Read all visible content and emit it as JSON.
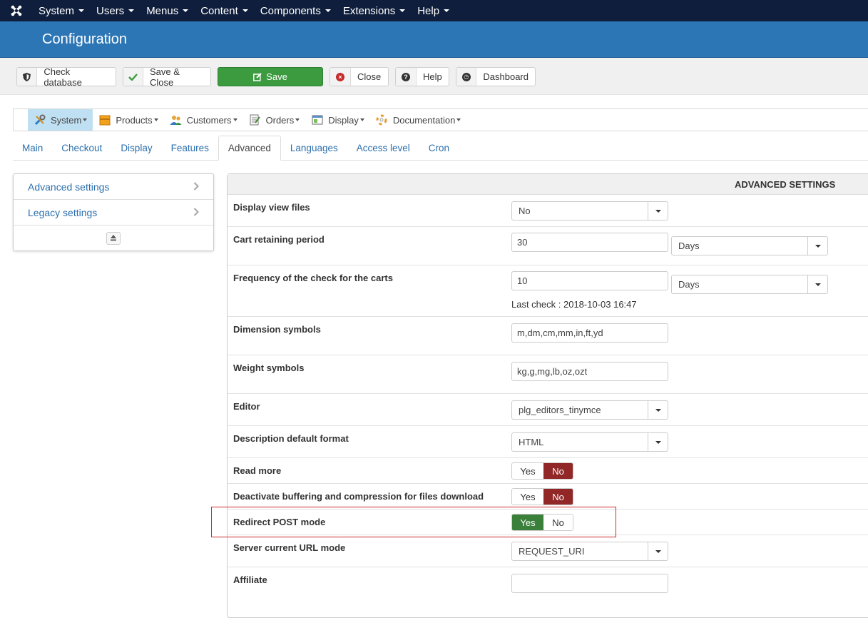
{
  "topbar": {
    "menu": [
      {
        "label": "System"
      },
      {
        "label": "Users"
      },
      {
        "label": "Menus"
      },
      {
        "label": "Content"
      },
      {
        "label": "Components"
      },
      {
        "label": "Extensions"
      },
      {
        "label": "Help"
      }
    ]
  },
  "header": {
    "title": "Configuration"
  },
  "toolbar": {
    "check_database": "Check database",
    "save_close": "Save & Close",
    "save": "Save",
    "close": "Close",
    "help": "Help",
    "dashboard": "Dashboard"
  },
  "mainmenu": {
    "items": [
      {
        "label": "System"
      },
      {
        "label": "Products"
      },
      {
        "label": "Customers"
      },
      {
        "label": "Orders"
      },
      {
        "label": "Display"
      },
      {
        "label": "Documentation"
      }
    ]
  },
  "tabs": [
    {
      "label": "Main"
    },
    {
      "label": "Checkout"
    },
    {
      "label": "Display"
    },
    {
      "label": "Features"
    },
    {
      "label": "Advanced"
    },
    {
      "label": "Languages"
    },
    {
      "label": "Access level"
    },
    {
      "label": "Cron"
    }
  ],
  "sidebar": {
    "items": [
      {
        "label": "Advanced settings"
      },
      {
        "label": "Legacy settings"
      }
    ]
  },
  "panel": {
    "heading": "ADVANCED SETTINGS",
    "display_view_files": {
      "label": "Display view files",
      "value": "No"
    },
    "cart_retaining": {
      "label": "Cart retaining period",
      "value": "30",
      "unit": "Days"
    },
    "cart_check_freq": {
      "label": "Frequency of the check for the carts",
      "value": "10",
      "unit": "Days",
      "last_check": "Last check : 2018-10-03 16:47"
    },
    "dimension_symbols": {
      "label": "Dimension symbols",
      "value": "m,dm,cm,mm,in,ft,yd"
    },
    "weight_symbols": {
      "label": "Weight symbols",
      "value": "kg,g,mg,lb,oz,ozt"
    },
    "editor": {
      "label": "Editor",
      "value": "plg_editors_tinymce"
    },
    "description_format": {
      "label": "Description default format",
      "value": "HTML"
    },
    "read_more": {
      "label": "Read more",
      "yes": "Yes",
      "no": "No",
      "selected": "No"
    },
    "deactivate_buffering": {
      "label": "Deactivate buffering and compression for files download",
      "yes": "Yes",
      "no": "No",
      "selected": "No"
    },
    "redirect_post": {
      "label": "Redirect POST mode",
      "yes": "Yes",
      "no": "No",
      "selected": "Yes"
    },
    "server_url_mode": {
      "label": "Server current URL mode",
      "value": "REQUEST_URI"
    },
    "affiliate": {
      "label": "Affiliate",
      "value": ""
    }
  }
}
